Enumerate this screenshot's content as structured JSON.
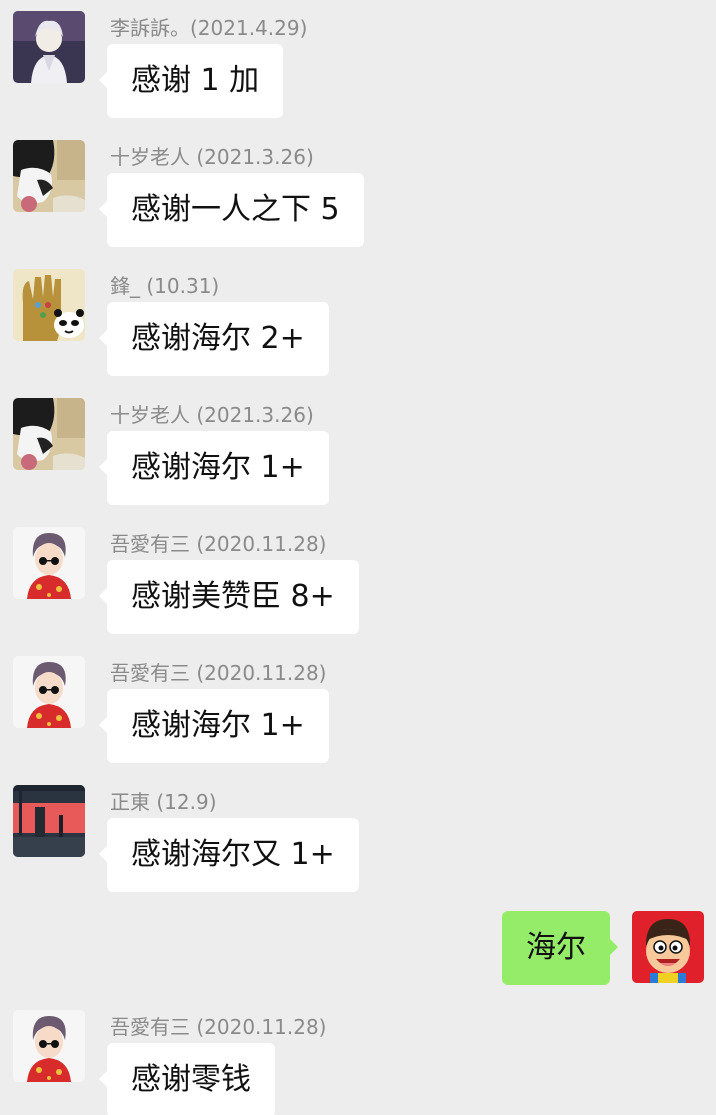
{
  "messages": [
    {
      "type": "incoming",
      "sender": "李訴訴。(2021.4.29)",
      "text": "感谢 1 加",
      "avatar": "anime-white-hair-avatar"
    },
    {
      "type": "incoming",
      "sender": "十岁老人 (2021.3.26)",
      "text": "感谢一人之下 5",
      "avatar": "cat-photo-avatar"
    },
    {
      "type": "incoming",
      "sender": "鋒_ (10.31)",
      "text": "感谢海尔 2+",
      "avatar": "panda-gauntlet-avatar"
    },
    {
      "type": "incoming",
      "sender": "十岁老人 (2021.3.26)",
      "text": "感谢海尔 1+",
      "avatar": "cat-photo-avatar"
    },
    {
      "type": "incoming",
      "sender": "吾愛有三 (2020.11.28)",
      "text": "感谢美赞臣 8+",
      "avatar": "cartoon-boy-sunglasses-avatar"
    },
    {
      "type": "incoming",
      "sender": "吾愛有三 (2020.11.28)",
      "text": "感谢海尔 1+",
      "avatar": "cartoon-boy-sunglasses-avatar"
    },
    {
      "type": "incoming",
      "sender": "正東 (12.9)",
      "text": "感谢海尔又 1+",
      "avatar": "red-sky-city-avatar"
    },
    {
      "type": "outgoing",
      "text": "海尔",
      "avatar": "wangzai-boy-avatar"
    },
    {
      "type": "incoming",
      "sender": "吾愛有三 (2020.11.28)",
      "text": "感谢零钱",
      "avatar": "cartoon-boy-sunglasses-avatar"
    }
  ],
  "colors": {
    "background": "#ededed",
    "incoming_bubble": "#ffffff",
    "outgoing_bubble": "#95ec69",
    "sender_text": "#8a8a8a"
  }
}
